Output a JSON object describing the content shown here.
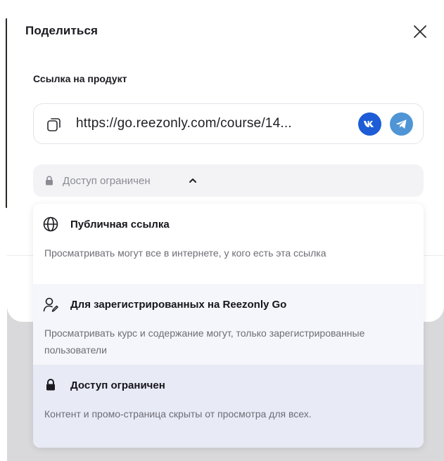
{
  "modal": {
    "title": "Поделиться",
    "close_icon": "close-icon"
  },
  "link_section": {
    "label": "Ссылка на продукт",
    "url": "https://go.reezonly.com/course/14...",
    "copy_icon": "copy-icon",
    "share": [
      {
        "name": "vk",
        "icon": "vk-icon",
        "color": "#1d5cd6"
      },
      {
        "name": "telegram",
        "icon": "telegram-icon",
        "color": "#4f95d6"
      }
    ]
  },
  "access": {
    "selected_label": "Доступ ограничен",
    "expanded": true,
    "options": [
      {
        "icon": "globe-icon",
        "title": "Публичная ссылка",
        "description": "Просматривать могут все в интернете, у кого есть эта ссылка",
        "highlighted": false
      },
      {
        "icon": "user-edit-icon",
        "title": "Для зарегистрированных на Reezonly Go",
        "description": "Просматривать курс и содержание могут, только зарегистрированные пользователи",
        "highlighted": false
      },
      {
        "icon": "lock-icon",
        "title": "Доступ ограничен",
        "description": "Контент и промо-страница скрыты от просмотра для всех.",
        "highlighted": true
      }
    ]
  },
  "colors": {
    "backdrop": "#d9d9dc",
    "option_hover": "#f5f6fb",
    "option_selected": "#e8eaf5",
    "muted_text": "#6d6d76"
  }
}
